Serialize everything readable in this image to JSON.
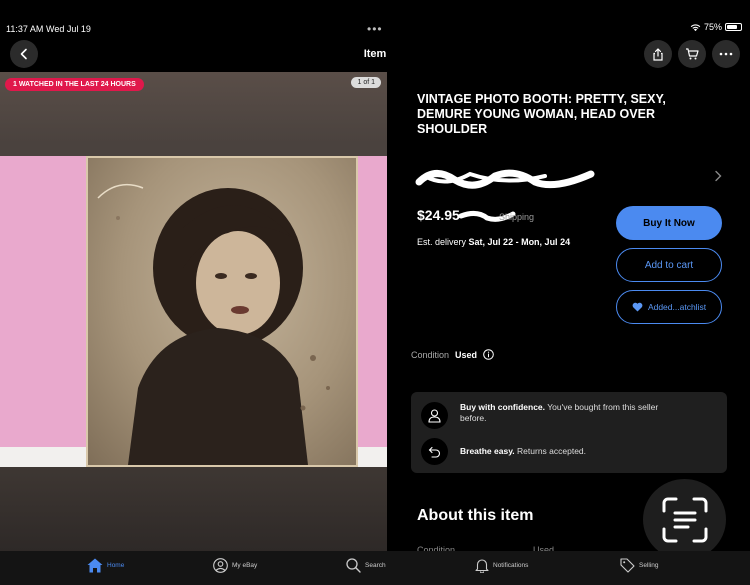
{
  "status_bar": {
    "time": "11:37 AM",
    "date": "Wed Jul 19",
    "battery": "75%",
    "battery_level": 0.75
  },
  "header": {
    "title": "Item"
  },
  "image": {
    "watched_badge": "1 WATCHED IN THE LAST 24 HOURS",
    "page_count": "1 of 1"
  },
  "item": {
    "title": "VINTAGE PHOTO BOOTH: PRETTY, SEXY, DEMURE YOUNG WOMAN, HEAD OVER SHOULDER",
    "price": "$24.95",
    "shipping": "Shipping",
    "delivery_label": "Est. delivery",
    "delivery_dates": "Sat, Jul 22 - Mon, Jul 24"
  },
  "actions": {
    "buy_now": "Buy It Now",
    "add_to_cart": "Add to cart",
    "watchlist": "Added...atchlist"
  },
  "condition": {
    "label": "Condition",
    "value": "Used"
  },
  "confidence": {
    "row1_bold": "Buy with confidence.",
    "row1_text": "You've bought from this seller before.",
    "row2_bold": "Breathe easy.",
    "row2_text": "Returns accepted."
  },
  "about": {
    "heading": "About this item",
    "cut_label": "Condition",
    "cut_value": "Used"
  },
  "tabs": {
    "home": "Home",
    "my_ebay": "My eBay",
    "search": "Search",
    "notifications": "Notifications",
    "selling": "Selling"
  },
  "colors": {
    "accent": "#4b8af0",
    "badge": "#e0184b"
  }
}
